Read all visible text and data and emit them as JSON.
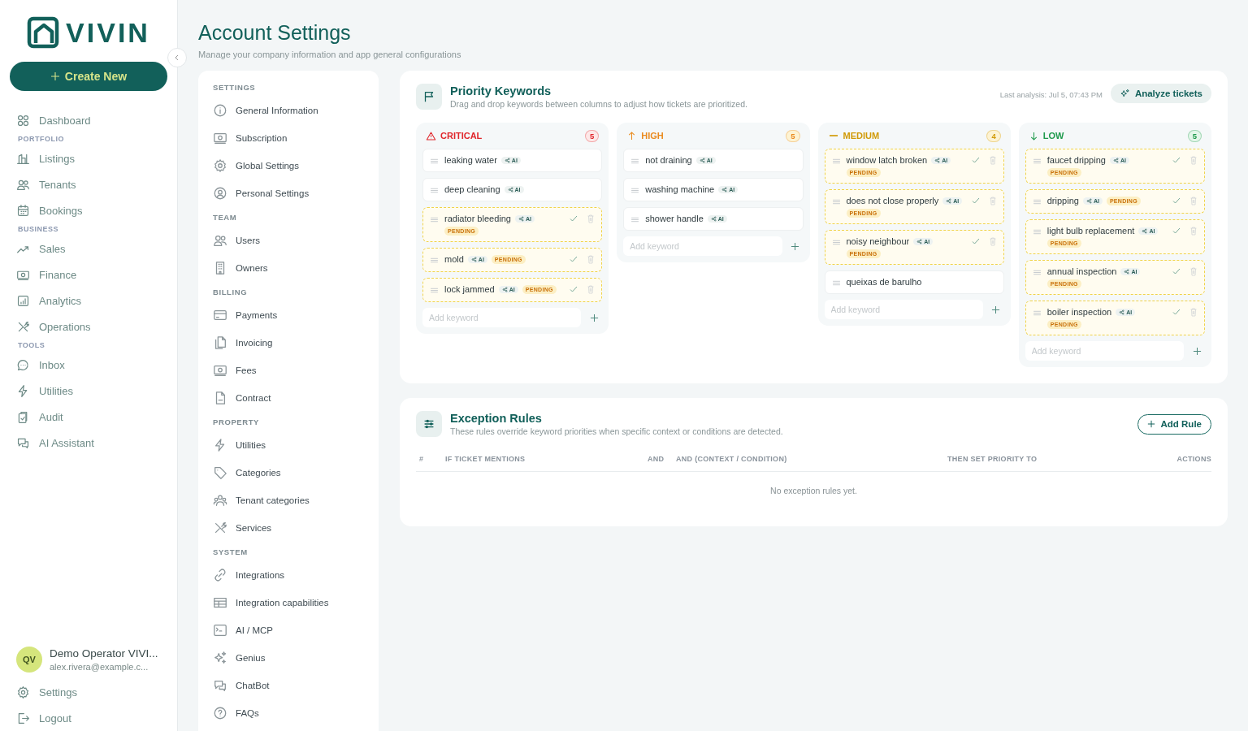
{
  "sidebar": {
    "logo": "VIVIN",
    "create_button": "Create New",
    "nav": [
      {
        "kind": "item",
        "label": "Dashboard"
      },
      {
        "kind": "section",
        "label": "PORTFOLIO"
      },
      {
        "kind": "item",
        "label": "Listings"
      },
      {
        "kind": "item",
        "label": "Tenants"
      },
      {
        "kind": "item",
        "label": "Bookings"
      },
      {
        "kind": "section",
        "label": "BUSINESS"
      },
      {
        "kind": "item",
        "label": "Sales"
      },
      {
        "kind": "item",
        "label": "Finance"
      },
      {
        "kind": "item",
        "label": "Analytics"
      },
      {
        "kind": "item",
        "label": "Operations"
      },
      {
        "kind": "section",
        "label": "TOOLS"
      },
      {
        "kind": "item",
        "label": "Inbox"
      },
      {
        "kind": "item",
        "label": "Utilities"
      },
      {
        "kind": "item",
        "label": "Audit"
      },
      {
        "kind": "item",
        "label": "AI Assistant"
      }
    ],
    "user": {
      "initials": "QV",
      "name": "Demo Operator VIVI...",
      "email": "alex.rivera@example.c..."
    },
    "footer": [
      "Settings",
      "Logout"
    ]
  },
  "page": {
    "title": "Account Settings",
    "subtitle": "Manage your company information and app general configurations"
  },
  "settings_nav": [
    {
      "kind": "section",
      "label": "SETTINGS"
    },
    {
      "kind": "item",
      "label": "General Information"
    },
    {
      "kind": "item",
      "label": "Subscription"
    },
    {
      "kind": "item",
      "label": "Global Settings"
    },
    {
      "kind": "item",
      "label": "Personal Settings"
    },
    {
      "kind": "section",
      "label": "TEAM"
    },
    {
      "kind": "item",
      "label": "Users"
    },
    {
      "kind": "item",
      "label": "Owners"
    },
    {
      "kind": "section",
      "label": "BILLING"
    },
    {
      "kind": "item",
      "label": "Payments"
    },
    {
      "kind": "item",
      "label": "Invoicing"
    },
    {
      "kind": "item",
      "label": "Fees"
    },
    {
      "kind": "item",
      "label": "Contract"
    },
    {
      "kind": "section",
      "label": "PROPERTY"
    },
    {
      "kind": "item",
      "label": "Utilities"
    },
    {
      "kind": "item",
      "label": "Categories"
    },
    {
      "kind": "item",
      "label": "Tenant categories"
    },
    {
      "kind": "item",
      "label": "Services"
    },
    {
      "kind": "section",
      "label": "SYSTEM"
    },
    {
      "kind": "item",
      "label": "Integrations"
    },
    {
      "kind": "item",
      "label": "Integration capabilities"
    },
    {
      "kind": "item",
      "label": "AI / MCP"
    },
    {
      "kind": "item",
      "label": "Genius"
    },
    {
      "kind": "item",
      "label": "ChatBot"
    },
    {
      "kind": "item",
      "label": "FAQs"
    }
  ],
  "priority_keywords": {
    "title": "Priority Keywords",
    "subtitle": "Drag and drop keywords between columns to adjust how tickets are prioritized.",
    "last_analysis": "Last analysis: Jul 5, 07:43 PM",
    "analyze_button": "Analyze tickets",
    "columns": [
      {
        "kind": "critical",
        "title": "CRITICAL",
        "count": "5",
        "placeholder": "Add keyword",
        "keywords": [
          {
            "text": "leaking water",
            "badge": "AI"
          },
          {
            "text": "deep cleaning",
            "badge": "AI"
          },
          {
            "text": "radiator bleeding",
            "badge": "AI",
            "status": "PENDING"
          },
          {
            "text": "mold",
            "badge": "AI",
            "status": "PENDING"
          },
          {
            "text": "lock jammed",
            "badge": "AI",
            "status": "PENDING"
          }
        ]
      },
      {
        "kind": "high",
        "title": "HIGH",
        "count": "5",
        "placeholder": "Add keyword",
        "keywords": [
          {
            "text": "not draining",
            "badge": "AI"
          },
          {
            "text": "washing machine",
            "badge": "AI"
          },
          {
            "text": "shower handle",
            "badge": "AI"
          }
        ]
      },
      {
        "kind": "medium",
        "title": "MEDIUM",
        "count": "4",
        "placeholder": "Add keyword",
        "keywords": [
          {
            "text": "window latch broken",
            "badge": "AI",
            "status": "PENDING"
          },
          {
            "text": "does not close properly",
            "badge": "AI",
            "status": "PENDING"
          },
          {
            "text": "noisy neighbour",
            "badge": "AI",
            "status": "PENDING"
          },
          {
            "text": "queixas de barulho"
          }
        ]
      },
      {
        "kind": "low",
        "title": "LOW",
        "count": "5",
        "placeholder": "Add keyword",
        "keywords": [
          {
            "text": "faucet dripping",
            "badge": "AI",
            "status": "PENDING"
          },
          {
            "text": "dripping",
            "badge": "AI",
            "status": "PENDING"
          },
          {
            "text": "light bulb replacement",
            "badge": "AI",
            "status": "PENDING"
          },
          {
            "text": "annual inspection",
            "badge": "AI",
            "status": "PENDING"
          },
          {
            "text": "boiler inspection",
            "badge": "AI",
            "status": "PENDING"
          }
        ]
      }
    ]
  },
  "exception_rules": {
    "title": "Exception Rules",
    "subtitle": "These rules override keyword priorities when specific context or conditions are detected.",
    "add_button": "Add Rule",
    "table": {
      "columns": [
        "#",
        "IF TICKET MENTIONS",
        "AND",
        "AND (CONTEXT / CONDITION)",
        "THEN SET PRIORITY TO",
        "ACTIONS"
      ],
      "empty": "No exception rules yet."
    }
  }
}
